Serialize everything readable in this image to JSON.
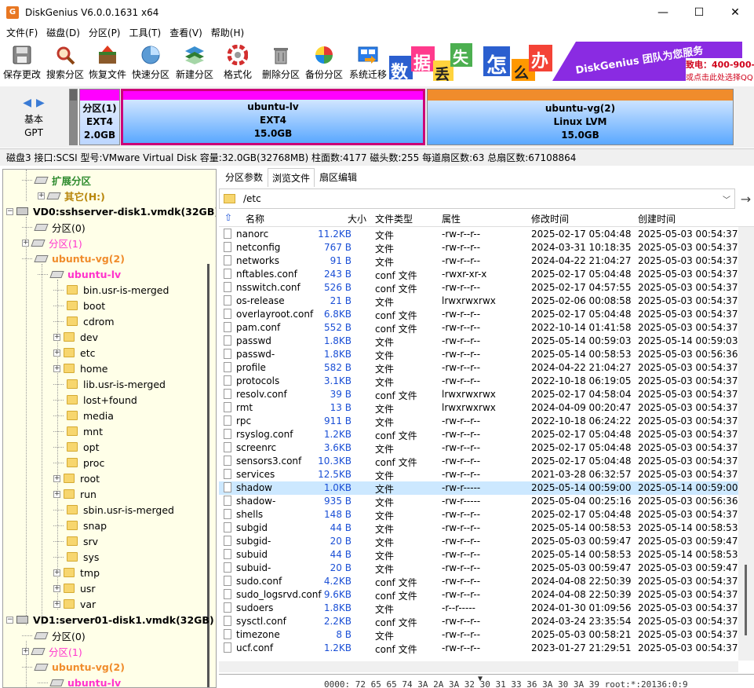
{
  "window": {
    "title": "DiskGenius V6.0.0.1631 x64",
    "app_icon": "G",
    "minimize": "—",
    "maximize": "☐",
    "close": "✕"
  },
  "menu": [
    "文件(F)",
    "磁盘(D)",
    "分区(P)",
    "工具(T)",
    "查看(V)",
    "帮助(H)"
  ],
  "toolbar": [
    {
      "label": "保存更改",
      "icon": "save-icon"
    },
    {
      "label": "搜索分区",
      "icon": "search-icon"
    },
    {
      "label": "恢复文件",
      "icon": "recover-icon"
    },
    {
      "label": "快速分区",
      "icon": "quick-partition-icon"
    },
    {
      "label": "新建分区",
      "icon": "new-partition-icon"
    },
    {
      "label": "格式化",
      "icon": "format-icon"
    },
    {
      "label": "删除分区",
      "icon": "delete-icon"
    },
    {
      "label": "备份分区",
      "icon": "backup-icon"
    },
    {
      "label": "系统迁移",
      "icon": "migrate-icon"
    }
  ],
  "banner": {
    "chars": [
      "数",
      "据",
      "丢",
      "失",
      "怎",
      "么",
      "办"
    ],
    "slogan": "DiskGenius 团队为您服务",
    "phone": "致电：400-900-",
    "qq": "或点击此处选择QQ"
  },
  "diskmap": {
    "disk_type": "基本",
    "partition_style": "GPT",
    "partitions": [
      {
        "name": "分区(1)",
        "fs": "EXT4",
        "size": "2.0GB"
      },
      {
        "name": "ubuntu-lv",
        "fs": "EXT4",
        "size": "15.0GB"
      },
      {
        "name": "ubuntu-vg(2)",
        "fs": "Linux LVM",
        "size": "15.0GB"
      }
    ]
  },
  "diskinfo": "磁盘3 接口:SCSI  型号:VMware Virtual Disk  容量:32.0GB(32768MB)  柱面数:4177  磁头数:255  每道扇区数:63  总扇区数:67108864",
  "tree": [
    {
      "label": "扩展分区",
      "color": "#2e8b2e",
      "bold": true
    },
    {
      "label": "其它(H:)",
      "color": "#b8860b",
      "bold": true
    },
    {
      "label": "VD0:sshserver-disk1.vmdk(32GB)",
      "bold": true
    },
    {
      "label": "分区(0)"
    },
    {
      "label": "分区(1)",
      "color": "#ff33cc"
    },
    {
      "label": "ubuntu-vg(2)",
      "color": "#f08c2c",
      "bold": true
    },
    {
      "label": "ubuntu-lv",
      "color": "#ff33cc",
      "bold": true
    },
    {
      "label": "bin.usr-is-merged"
    },
    {
      "label": "boot"
    },
    {
      "label": "cdrom"
    },
    {
      "label": "dev"
    },
    {
      "label": "etc"
    },
    {
      "label": "home"
    },
    {
      "label": "lib.usr-is-merged"
    },
    {
      "label": "lost+found"
    },
    {
      "label": "media"
    },
    {
      "label": "mnt"
    },
    {
      "label": "opt"
    },
    {
      "label": "proc"
    },
    {
      "label": "root"
    },
    {
      "label": "run"
    },
    {
      "label": "sbin.usr-is-merged"
    },
    {
      "label": "snap"
    },
    {
      "label": "srv"
    },
    {
      "label": "sys"
    },
    {
      "label": "tmp"
    },
    {
      "label": "usr"
    },
    {
      "label": "var"
    },
    {
      "label": "VD1:server01-disk1.vmdk(32GB)",
      "bold": true
    },
    {
      "label": "分区(0)"
    },
    {
      "label": "分区(1)",
      "color": "#ff33cc"
    },
    {
      "label": "ubuntu-vg(2)",
      "color": "#f08c2c",
      "bold": true
    },
    {
      "label": "ubuntu-lv",
      "color": "#ff33cc",
      "bold": true
    }
  ],
  "tabs": [
    "分区参数",
    "浏览文件",
    "扇区编辑"
  ],
  "path": "/etc",
  "columns": [
    "名称",
    "大小",
    "文件类型",
    "属性",
    "修改时间",
    "创建时间"
  ],
  "files": [
    [
      "nanorc",
      "11.2KB",
      "文件",
      "-rw-r--r--",
      "2025-02-17 05:04:48",
      "2025-05-03 00:54:37"
    ],
    [
      "netconfig",
      "767 B",
      "文件",
      "-rw-r--r--",
      "2024-03-31 10:18:35",
      "2025-05-03 00:54:37"
    ],
    [
      "networks",
      "91 B",
      "文件",
      "-rw-r--r--",
      "2024-04-22 21:04:27",
      "2025-05-03 00:54:37"
    ],
    [
      "nftables.conf",
      "243 B",
      "conf 文件",
      "-rwxr-xr-x",
      "2025-02-17 05:04:48",
      "2025-05-03 00:54:37"
    ],
    [
      "nsswitch.conf",
      "526 B",
      "conf 文件",
      "-rw-r--r--",
      "2025-02-17 04:57:55",
      "2025-05-03 00:54:37"
    ],
    [
      "os-release",
      "21 B",
      "文件",
      "lrwxrwxrwx",
      "2025-02-06 00:08:58",
      "2025-05-03 00:54:37"
    ],
    [
      "overlayroot.conf",
      "6.8KB",
      "conf 文件",
      "-rw-r--r--",
      "2025-02-17 05:04:48",
      "2025-05-03 00:54:37"
    ],
    [
      "pam.conf",
      "552 B",
      "conf 文件",
      "-rw-r--r--",
      "2022-10-14 01:41:58",
      "2025-05-03 00:54:37"
    ],
    [
      "passwd",
      "1.8KB",
      "文件",
      "-rw-r--r--",
      "2025-05-14 00:59:03",
      "2025-05-14 00:59:03"
    ],
    [
      "passwd-",
      "1.8KB",
      "文件",
      "-rw-r--r--",
      "2025-05-14 00:58:53",
      "2025-05-03 00:56:36"
    ],
    [
      "profile",
      "582 B",
      "文件",
      "-rw-r--r--",
      "2024-04-22 21:04:27",
      "2025-05-03 00:54:37"
    ],
    [
      "protocols",
      "3.1KB",
      "文件",
      "-rw-r--r--",
      "2022-10-18 06:19:05",
      "2025-05-03 00:54:37"
    ],
    [
      "resolv.conf",
      "39 B",
      "conf 文件",
      "lrwxrwxrwx",
      "2025-02-17 04:58:04",
      "2025-05-03 00:54:37"
    ],
    [
      "rmt",
      "13 B",
      "文件",
      "lrwxrwxrwx",
      "2024-04-09 00:20:47",
      "2025-05-03 00:54:37"
    ],
    [
      "rpc",
      "911 B",
      "文件",
      "-rw-r--r--",
      "2022-10-18 06:24:22",
      "2025-05-03 00:54:37"
    ],
    [
      "rsyslog.conf",
      "1.2KB",
      "conf 文件",
      "-rw-r--r--",
      "2025-02-17 05:04:48",
      "2025-05-03 00:54:37"
    ],
    [
      "screenrc",
      "3.6KB",
      "文件",
      "-rw-r--r--",
      "2025-02-17 05:04:48",
      "2025-05-03 00:54:37"
    ],
    [
      "sensors3.conf",
      "10.3KB",
      "conf 文件",
      "-rw-r--r--",
      "2025-02-17 05:04:48",
      "2025-05-03 00:54:37"
    ],
    [
      "services",
      "12.5KB",
      "文件",
      "-rw-r--r--",
      "2021-03-28 06:32:57",
      "2025-05-03 00:54:37"
    ],
    [
      "shadow",
      "1.0KB",
      "文件",
      "-rw-r-----",
      "2025-05-14 00:59:00",
      "2025-05-14 00:59:00"
    ],
    [
      "shadow-",
      "935 B",
      "文件",
      "-rw-r-----",
      "2025-05-04 00:25:16",
      "2025-05-03 00:56:36"
    ],
    [
      "shells",
      "148 B",
      "文件",
      "-rw-r--r--",
      "2025-02-17 05:04:48",
      "2025-05-03 00:54:37"
    ],
    [
      "subgid",
      "44 B",
      "文件",
      "-rw-r--r--",
      "2025-05-14 00:58:53",
      "2025-05-14 00:58:53"
    ],
    [
      "subgid-",
      "20 B",
      "文件",
      "-rw-r--r--",
      "2025-05-03 00:59:47",
      "2025-05-03 00:59:47"
    ],
    [
      "subuid",
      "44 B",
      "文件",
      "-rw-r--r--",
      "2025-05-14 00:58:53",
      "2025-05-14 00:58:53"
    ],
    [
      "subuid-",
      "20 B",
      "文件",
      "-rw-r--r--",
      "2025-05-03 00:59:47",
      "2025-05-03 00:59:47"
    ],
    [
      "sudo.conf",
      "4.2KB",
      "conf 文件",
      "-rw-r--r--",
      "2024-04-08 22:50:39",
      "2025-05-03 00:54:37"
    ],
    [
      "sudo_logsrvd.conf",
      "9.6KB",
      "conf 文件",
      "-rw-r--r--",
      "2024-04-08 22:50:39",
      "2025-05-03 00:54:37"
    ],
    [
      "sudoers",
      "1.8KB",
      "文件",
      "-r--r-----",
      "2024-01-30 01:09:56",
      "2025-05-03 00:54:37"
    ],
    [
      "sysctl.conf",
      "2.2KB",
      "conf 文件",
      "-rw-r--r--",
      "2024-03-24 23:35:54",
      "2025-05-03 00:54:37"
    ],
    [
      "timezone",
      "8 B",
      "文件",
      "-rw-r--r--",
      "2025-05-03 00:58:21",
      "2025-05-03 00:54:37"
    ],
    [
      "ucf.conf",
      "1.2KB",
      "conf 文件",
      "-rw-r--r--",
      "2023-01-27 21:29:51",
      "2025-05-03 00:54:37"
    ]
  ],
  "selected_file": "shadow",
  "hex_line": "0000: 72 65 65 74 3A 2A 3A 32 30 31 33 36 3A 30 3A 39   root:*:20136:0:9",
  "colors": {
    "size_blue": "#1a4fd6",
    "selected_bg": "#cce8ff",
    "tree_bg": "#ffffe8",
    "lv_border": "#cc0077",
    "vg_orange": "#f08c2c"
  }
}
